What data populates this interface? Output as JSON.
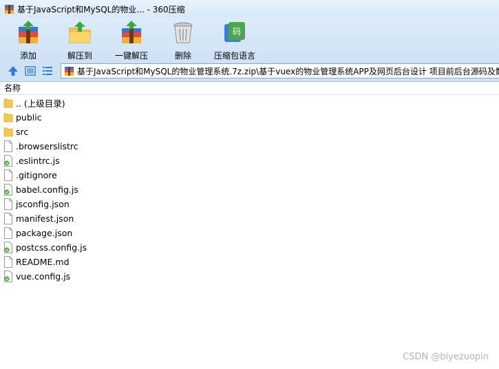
{
  "window": {
    "title": "基于JavaScript和MySQL的物业... - 360压缩"
  },
  "toolbar": {
    "items": [
      {
        "label": "添加",
        "icon": "add-archive-icon"
      },
      {
        "label": "解压到",
        "icon": "extract-to-icon"
      },
      {
        "label": "一键解压",
        "icon": "one-click-extract-icon"
      },
      {
        "label": "删除",
        "icon": "delete-trash-icon"
      },
      {
        "label": "压缩包语言",
        "icon": "archive-language-icon"
      }
    ]
  },
  "address_bar": {
    "path": "基于JavaScript和MySQL的物业管理系统.7z.zip\\基于vuex的物业管理系统APP及网页后台设计 项目前后台源码及数"
  },
  "list": {
    "column_name": "名称",
    "items": [
      {
        "name": ".. (上级目录)",
        "type": "folder"
      },
      {
        "name": "public",
        "type": "folder"
      },
      {
        "name": "src",
        "type": "folder"
      },
      {
        "name": ".browserslistrc",
        "type": "file"
      },
      {
        "name": ".eslintrc.js",
        "type": "js"
      },
      {
        "name": ".gitignore",
        "type": "file"
      },
      {
        "name": "babel.config.js",
        "type": "js"
      },
      {
        "name": "jsconfig.json",
        "type": "file"
      },
      {
        "name": "manifest.json",
        "type": "file"
      },
      {
        "name": "package.json",
        "type": "file"
      },
      {
        "name": "postcss.config.js",
        "type": "js"
      },
      {
        "name": "README.md",
        "type": "file"
      },
      {
        "name": "vue.config.js",
        "type": "js"
      }
    ]
  },
  "watermark": "CSDN @biyezuopin",
  "colors": {
    "toolbar_bg": "#d5e7f8",
    "folder": "#f5c94c",
    "accent_blue": "#2a7fd4"
  }
}
